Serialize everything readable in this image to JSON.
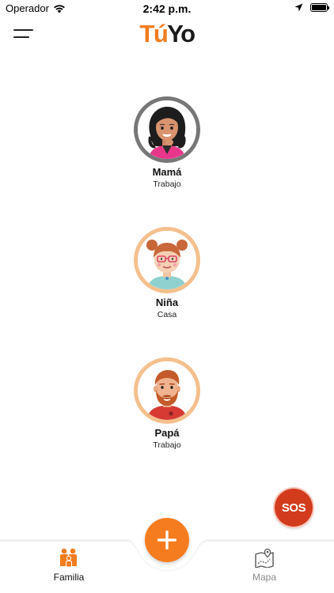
{
  "status_bar": {
    "carrier": "Operador",
    "time": "2:42 p.m.",
    "icons": [
      "wifi-icon",
      "location-arrow-icon",
      "battery-icon"
    ],
    "battery_level": 1.0
  },
  "header": {
    "menu_icon": "hamburger-menu-icon",
    "logo": {
      "part1": "Tú",
      "part2": "Yo"
    }
  },
  "family": [
    {
      "name": "Mamá",
      "place": "Trabajo",
      "avatar": "mother-avatar",
      "ring_color": "#777777"
    },
    {
      "name": "Niña",
      "place": "Casa",
      "avatar": "girl-avatar",
      "ring_color": "#f4c08d"
    },
    {
      "name": "Papá",
      "place": "Trabajo",
      "avatar": "father-avatar",
      "ring_color": "#f4c08d"
    }
  ],
  "sos": {
    "label": "SOS",
    "color": "#d23c1d"
  },
  "tab_bar": {
    "tabs": [
      {
        "label": "Familia",
        "icon": "family-icon",
        "active": true
      },
      {
        "label": "Mapa",
        "icon": "map-icon",
        "active": false
      }
    ],
    "add_icon": "plus-icon",
    "add_color": "#f57c1f"
  },
  "colors": {
    "accent": "#f07c1c",
    "sos": "#d23c1d"
  }
}
